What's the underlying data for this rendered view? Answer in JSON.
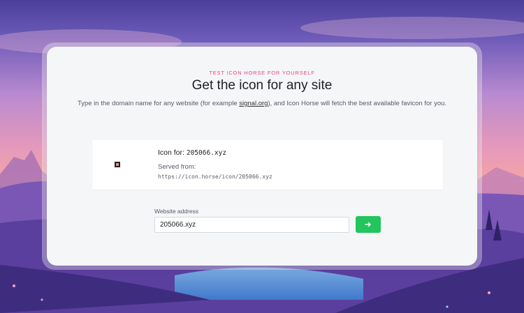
{
  "header": {
    "eyebrow": "TEST ICON HORSE FOR YOURSELF",
    "title": "Get the icon for any site",
    "subtitle_before": "Type in the domain name for any website (for example ",
    "subtitle_link": "signal.org",
    "subtitle_after": "), and Icon Horse will fetch the best available favicon for you."
  },
  "result": {
    "icon_for_label": "Icon for:",
    "domain": "205066.xyz",
    "served_from_label": "Served from:",
    "url": "https://icon.horse/icon/205066.xyz",
    "favicon": "favicon-image"
  },
  "form": {
    "label": "Website address",
    "value": "205066.xyz",
    "submit_icon": "arrow-right-icon"
  },
  "colors": {
    "accent_pink": "#e8457f",
    "button_green": "#22c55e"
  }
}
